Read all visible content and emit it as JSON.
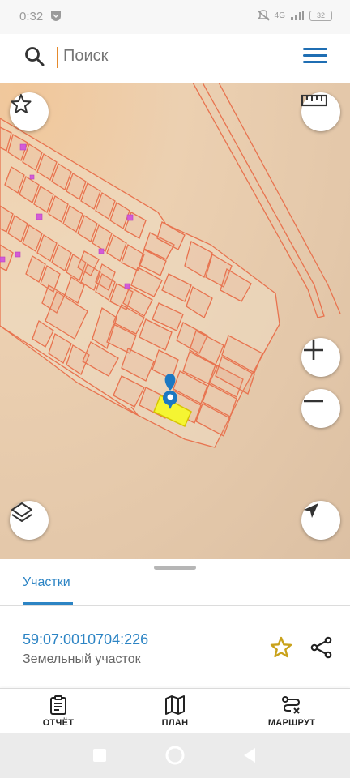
{
  "status_bar": {
    "time": "0:32",
    "network": "4G",
    "battery": "32"
  },
  "search": {
    "placeholder": "Поиск"
  },
  "map": {
    "highlight_color": "#f5f532",
    "marker_color": "#1b78c2",
    "parcel_line_color": "#e8734f"
  },
  "panel": {
    "tab_label": "Участки",
    "parcel_number": "59:07:0010704:226",
    "parcel_type": "Земельный участок"
  },
  "bottom_nav": {
    "report": "ОТЧЁТ",
    "plan": "ПЛАН",
    "route": "МАРШРУТ"
  },
  "icons": {
    "search": "search-icon",
    "menu": "hamburger-menu-icon",
    "favorites": "star-icon",
    "ruler": "ruler-icon",
    "zoom_in": "plus-icon",
    "zoom_out": "minus-icon",
    "layers": "layers-icon",
    "locate": "navigation-arrow-icon",
    "share": "share-icon",
    "report": "clipboard-icon",
    "plan": "map-icon",
    "route": "route-icon"
  }
}
